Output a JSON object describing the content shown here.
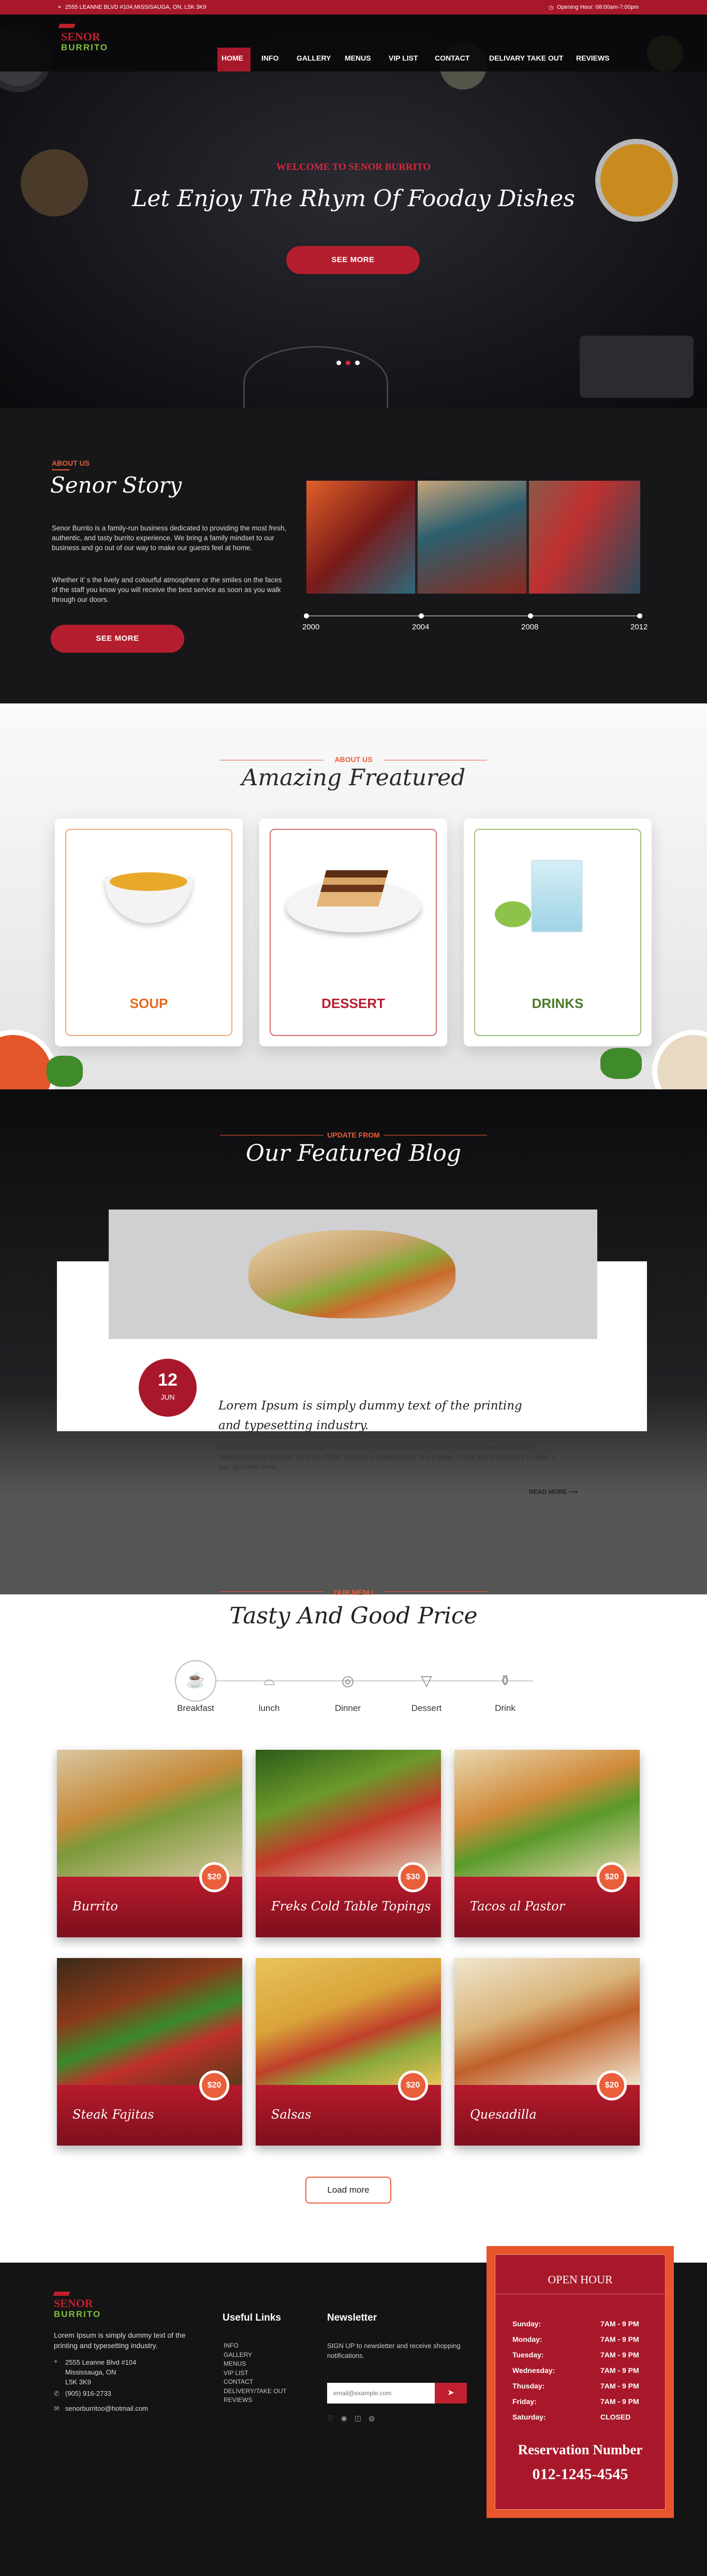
{
  "colors": {
    "brand_red": "#a8182a",
    "accent_orange": "#e95f3a",
    "dark": "#17171a"
  },
  "topbar": {
    "address": "2555 LEANNE BLVD #104,MISSISAUGA, ON, L5K 3K9",
    "hours": "Opening Hour: 08:00am-7:00pm"
  },
  "logo": {
    "line1": "SENOR",
    "line2": "BURRITO"
  },
  "nav": {
    "items": [
      "HOME",
      "INFO",
      "GALLERY",
      "MENUS",
      "VIP LIST",
      "CONTACT",
      "DELIVARY TAKE OUT",
      "REVIEWS"
    ]
  },
  "hero": {
    "welcome": "WELCOME TO SENOR BURRITO",
    "headline": "Let Enjoy The Rhym Of Fooday Dishes",
    "button": "SEE MORE"
  },
  "story": {
    "eyebrow": "ABOUT US",
    "title": "Senor Story",
    "para1": "Senor Burrito is a family-run business dedicated to providing the most fresh, authentic, and tasty burrito experience. We bring a family mindset to our business and go out of our way to make our guests feel at home.",
    "para2": "Whether it’ s the lively and colourful atmosphere or the smiles on the faces of the staff you know you will receive the best service as soon as you walk through our doors.",
    "button": "SEE MORE",
    "years": [
      "2000",
      "2004",
      "2008",
      "2012"
    ]
  },
  "featured": {
    "eyebrow": "ABOUT US",
    "title": "Amazing Freatured",
    "cards": [
      {
        "label": "SOUP",
        "color": "#e46a1e"
      },
      {
        "label": "DESSERT",
        "color": "#b51e2e"
      },
      {
        "label": "DRINKS",
        "color": "#4c7a2a"
      }
    ]
  },
  "blog": {
    "eyebrow": "UPDATE FROM",
    "title": "Our Featured Blog",
    "day": "12",
    "month": "JUN",
    "post_title": "Lorem Ipsum is simply dummy text of the printing and typesetting industry.",
    "post_body": "Lorem Ipsum is simply dummy text of the printing and typesetting industry. Lorem Ipsum has been the industry's standard dummy text ever since the 1500s, when an unknown printer took a galley of type and scrambled it to make a type specimen book.",
    "read_more": "READ MORE"
  },
  "menu": {
    "eyebrow": "OUR MENU",
    "title": "Tasty And Good Price",
    "steps": [
      {
        "label": "Breakfast",
        "icon": "cup-icon"
      },
      {
        "label": "lunch",
        "icon": "cloche-icon"
      },
      {
        "label": "Dinner",
        "icon": "plate-icon"
      },
      {
        "label": "Dessert",
        "icon": "icecream-icon"
      },
      {
        "label": "Drink",
        "icon": "bottle-icon"
      }
    ],
    "dishes": [
      {
        "name": "Burrito",
        "price": "$20"
      },
      {
        "name": "Freks Cold Table Topings",
        "price": "$30"
      },
      {
        "name": "Tacos al Pastor",
        "price": "$20"
      },
      {
        "name": "Steak Fajitas",
        "price": "$20"
      },
      {
        "name": "Salsas",
        "price": "$20"
      },
      {
        "name": "Quesadilla",
        "price": "$20"
      }
    ],
    "load_more": "Load more"
  },
  "footer": {
    "about": "Lorem Ipsum is simply dummy text of the printing and typesetting industry.",
    "address_line1": "2555 Leanne Blvd #104",
    "address_line2": "Mississauga, ON",
    "address_line3": "L5K 3K9",
    "phone": "(905) 916-2733",
    "email": "senorburritoo@hotmail.com",
    "links_title": "Useful Links",
    "links": [
      "INFO",
      "GALLERY",
      "MENUS",
      "VIP LIST",
      "CONTACT",
      "DELIVERY/TAKE OUT",
      "REVIEWS"
    ],
    "newsletter_title": "Newsletter",
    "newsletter_text": "SIGN UP to newsletter and receive shopping notifications.",
    "email_placeholder": "email@example.com",
    "hours_title": "OPEN HOUR",
    "hours": [
      {
        "day": "Sunday:",
        "time": "7AM - 9 PM"
      },
      {
        "day": "Monday:",
        "time": "7AM - 9 PM"
      },
      {
        "day": "Tuesday:",
        "time": "7AM - 9 PM"
      },
      {
        "day": "Wednesday:",
        "time": "7AM - 9 PM"
      },
      {
        "day": "Thusday:",
        "time": "7AM - 9 PM"
      },
      {
        "day": "Friday:",
        "time": "7AM - 9 PM"
      },
      {
        "day": "Saturday:",
        "time": "CLOSED"
      }
    ],
    "reservation_label": "Reservation Number",
    "reservation_number": "012-1245-4545"
  }
}
